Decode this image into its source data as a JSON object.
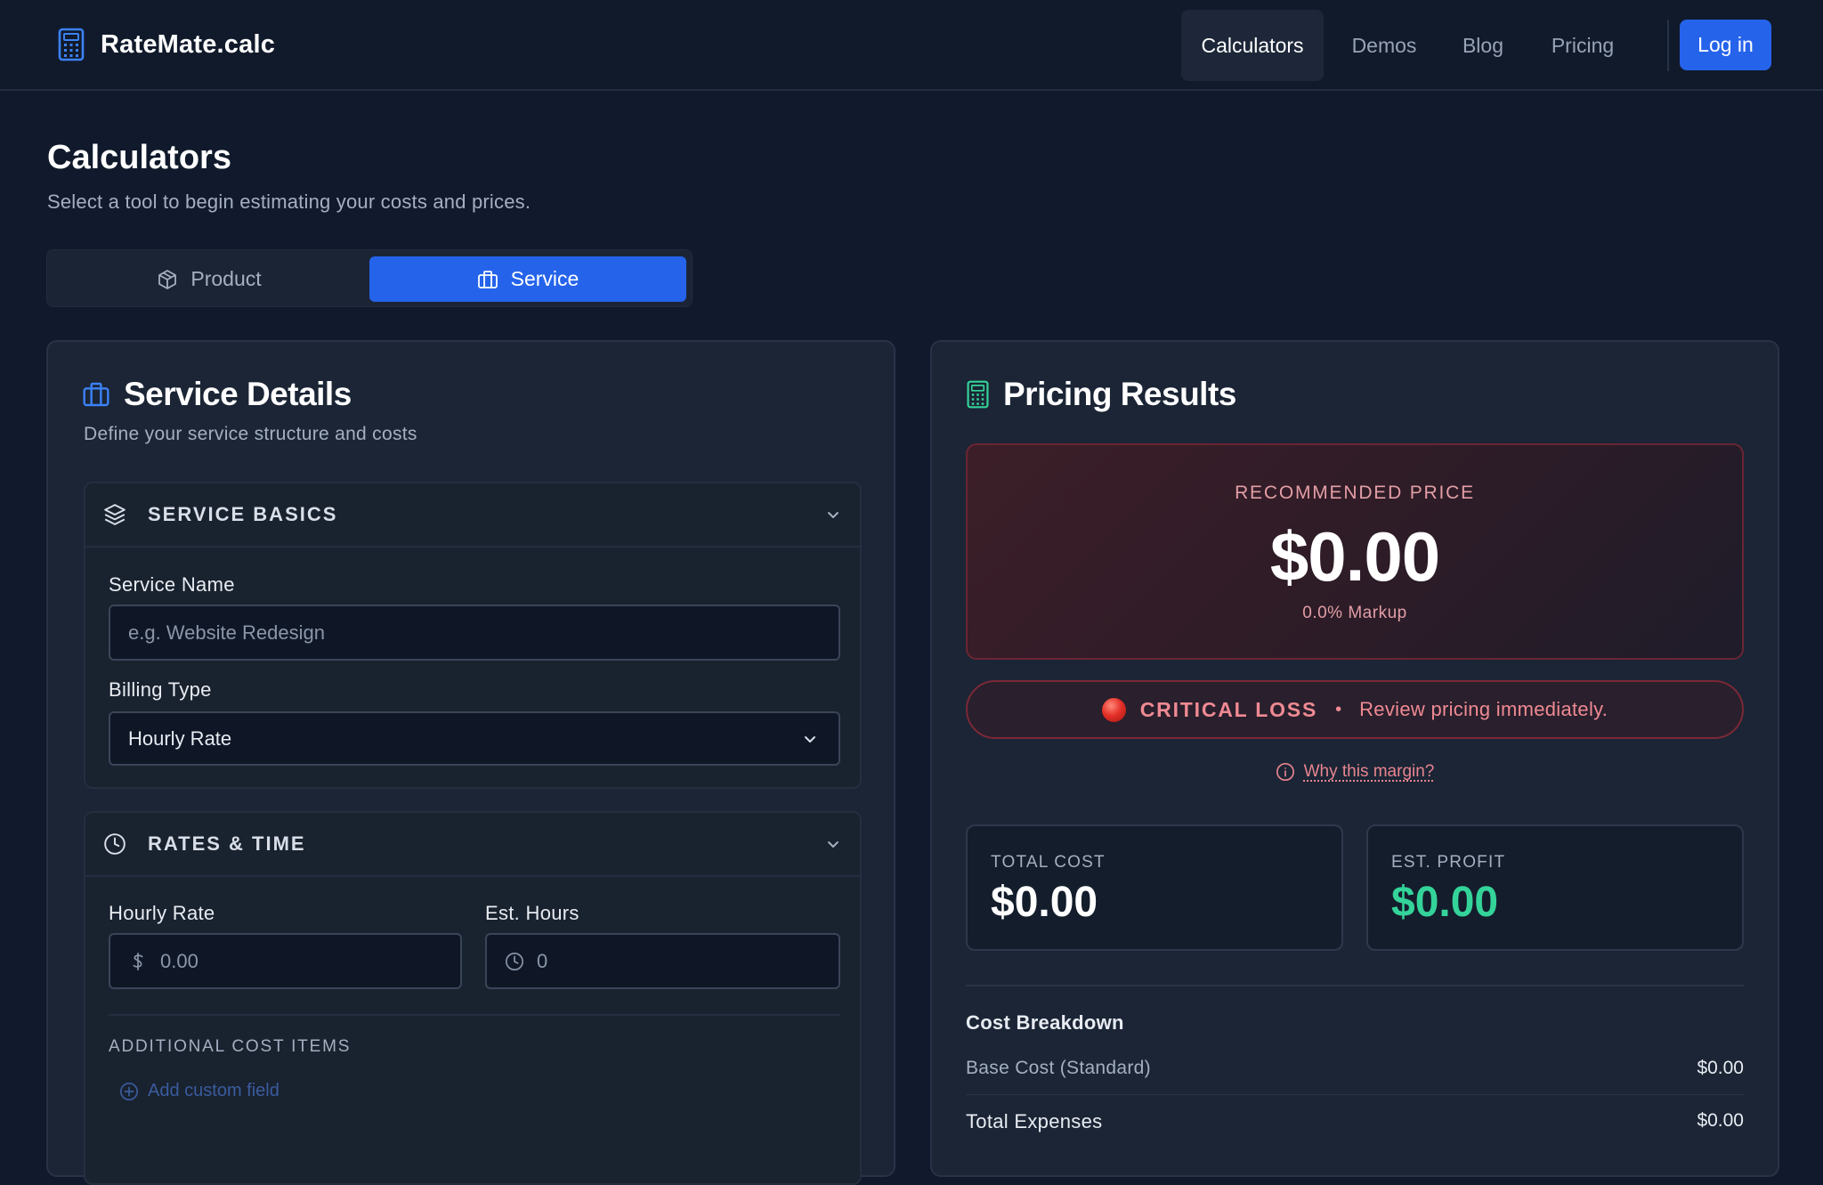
{
  "brand": {
    "name": "RateMate.calc"
  },
  "nav": {
    "items": [
      {
        "label": "Calculators",
        "active": true
      },
      {
        "label": "Demos"
      },
      {
        "label": "Blog"
      },
      {
        "label": "Pricing"
      }
    ],
    "login_label": "Log in"
  },
  "page": {
    "title": "Calculators",
    "subtitle": "Select a tool to begin estimating your costs and prices."
  },
  "tabs": [
    {
      "label": "Product",
      "active": false
    },
    {
      "label": "Service",
      "active": true
    }
  ],
  "service_card": {
    "title": "Service Details",
    "subtitle": "Define your service structure and costs",
    "basics": {
      "heading": "SERVICE BASICS",
      "service_name_label": "Service Name",
      "service_name_placeholder": "e.g. Website Redesign",
      "billing_type_label": "Billing Type",
      "billing_type_value": "Hourly Rate"
    },
    "rates": {
      "heading": "RATES & TIME",
      "hourly_rate_label": "Hourly Rate",
      "hourly_rate_value": "0.00",
      "est_hours_label": "Est. Hours",
      "est_hours_value": "0",
      "additional_caption": "ADDITIONAL COST ITEMS",
      "add_field_label": "Add custom field"
    }
  },
  "results_card": {
    "title": "Pricing Results",
    "recommended_label": "RECOMMENDED PRICE",
    "recommended_value": "$0.00",
    "markup": "0.0% Markup",
    "alert_status": "CRITICAL LOSS",
    "alert_message": "Review pricing immediately.",
    "why_link": "Why this margin?",
    "total_cost_label": "TOTAL COST",
    "total_cost_value": "$0.00",
    "est_profit_label": "EST. PROFIT",
    "est_profit_value": "$0.00",
    "breakdown_title": "Cost Breakdown",
    "breakdown": [
      {
        "label": "Base Cost (Standard)",
        "value": "$0.00"
      },
      {
        "label": "Total Expenses",
        "value": "$0.00"
      }
    ]
  },
  "colors": {
    "accent": "#2563eb",
    "background": "#101a2c",
    "card": "#1b2535",
    "danger": "#ef8a93",
    "profit": "#34d399"
  }
}
